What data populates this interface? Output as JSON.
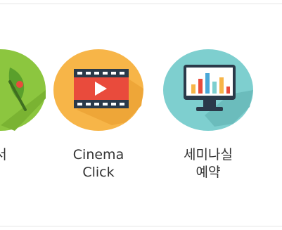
{
  "colors": {
    "divider": "#e6e6e6",
    "label_text": "#333333",
    "partial_circle": "#8cc63f",
    "cinema_circle": "#f7b548",
    "cinema_film": "#e94b3c",
    "seminar_circle": "#7ecfcf",
    "monitor_frame": "#2b3a4a"
  },
  "tiles": [
    {
      "label": "서",
      "icon": "leaf-icon"
    },
    {
      "label": "Cinema\nClick",
      "icon": "film-play-icon"
    },
    {
      "label": "세미나실\n예약",
      "icon": "monitor-chart-icon"
    }
  ]
}
